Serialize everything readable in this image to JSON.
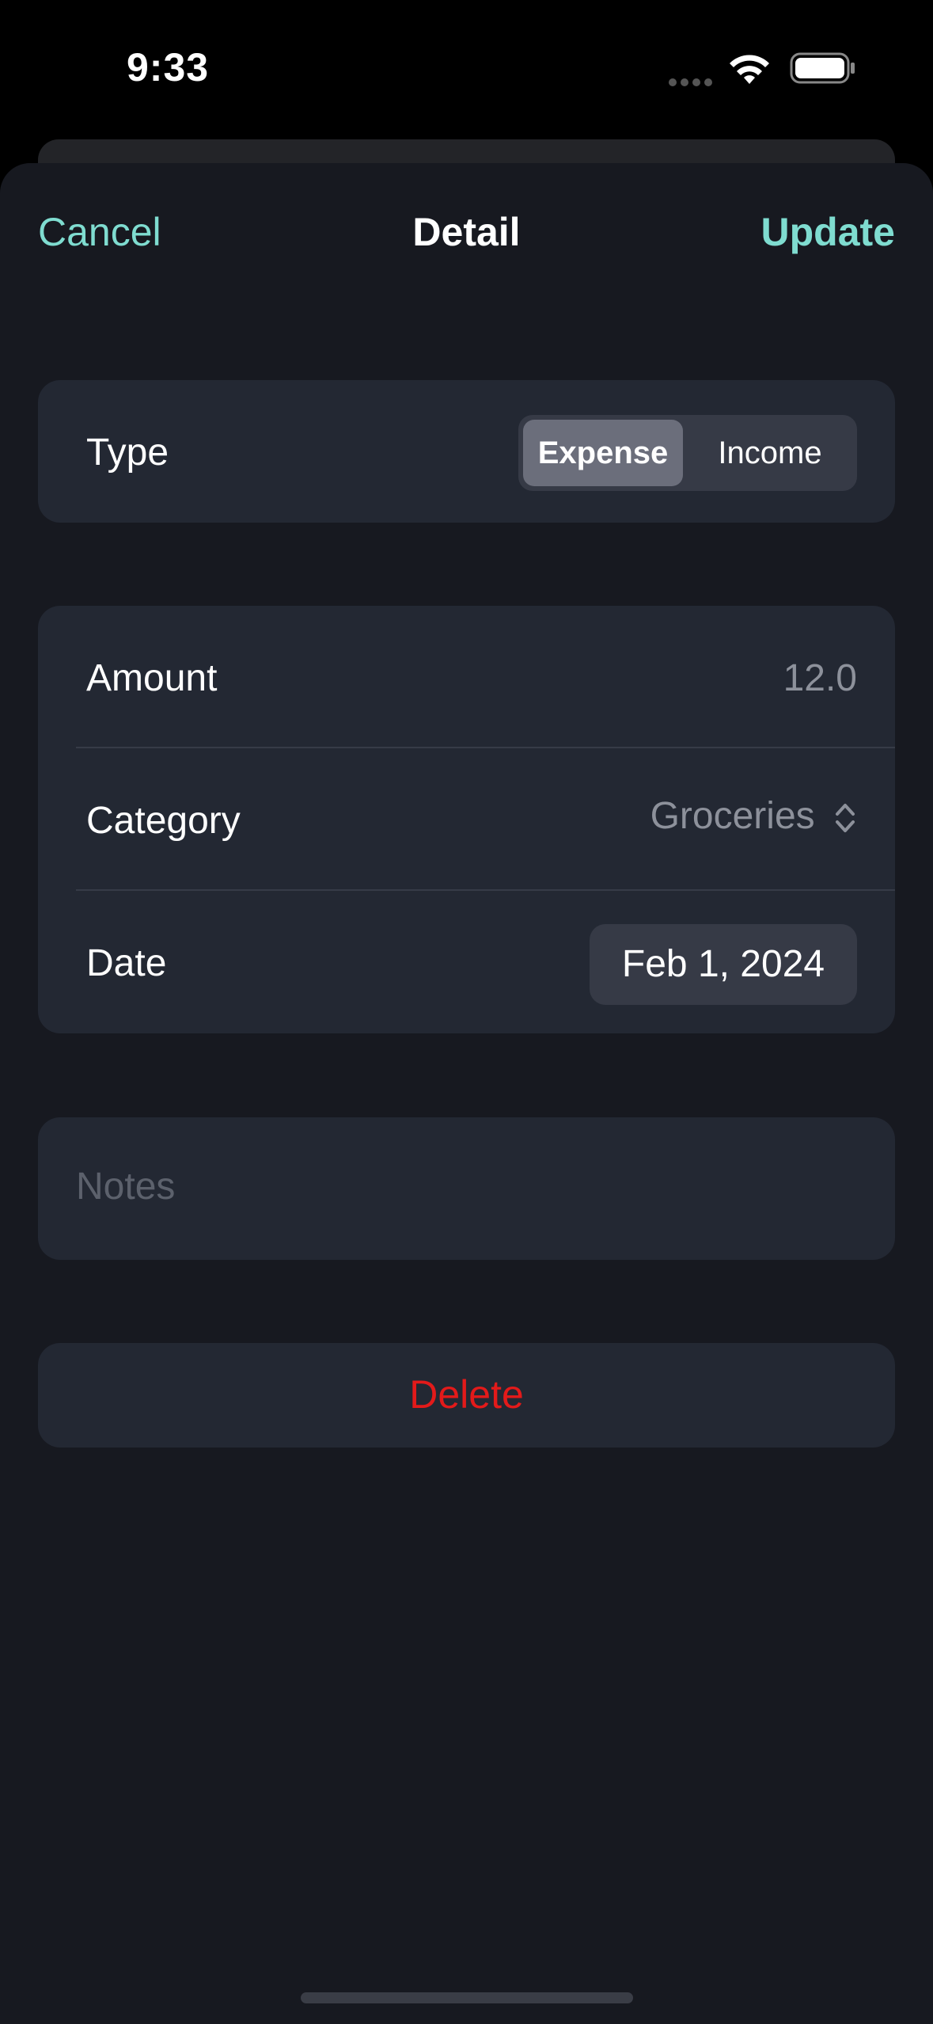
{
  "status_bar": {
    "time": "9:33",
    "icons": [
      "signal-dots-icon",
      "wifi-icon",
      "battery-icon"
    ]
  },
  "nav": {
    "cancel_label": "Cancel",
    "title": "Detail",
    "update_label": "Update"
  },
  "type_section": {
    "label": "Type",
    "options": [
      "Expense",
      "Income"
    ],
    "selected": "Expense"
  },
  "details": {
    "amount_label": "Amount",
    "amount_value": "12.0",
    "category_label": "Category",
    "category_value": "Groceries",
    "date_label": "Date",
    "date_value": "Feb 1, 2024"
  },
  "notes": {
    "placeholder": "Notes"
  },
  "delete_label": "Delete",
  "colors": {
    "accent": "#7fdcd0",
    "destructive": "#e31a1a",
    "background": "#171920",
    "card": "#232833"
  }
}
